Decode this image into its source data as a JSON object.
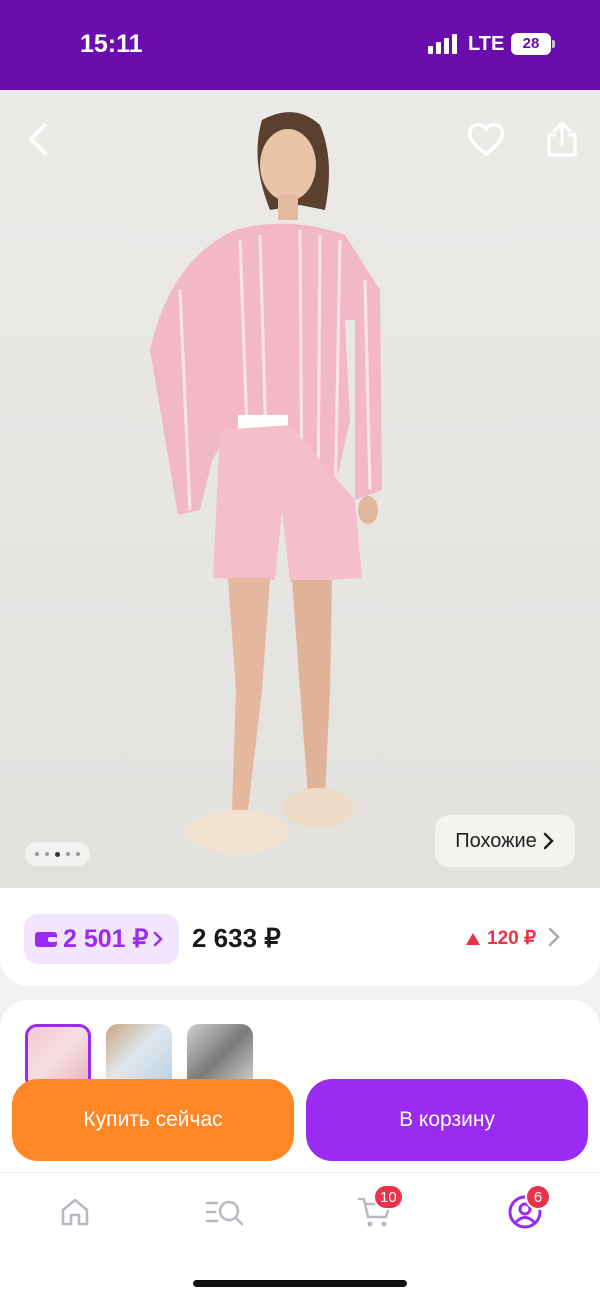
{
  "status_bar": {
    "time": "15:11",
    "network": "LTE",
    "battery": "28"
  },
  "product": {
    "similar_label": "Похожие",
    "photo_index": 3,
    "photo_count": 5,
    "wallet_price": "2 501 ₽",
    "regular_price": "2 633 ₽",
    "price_diff": "120 ₽"
  },
  "actions": {
    "buy_now": "Купить сейчас",
    "add_to_cart": "В корзину"
  },
  "tabbar": {
    "cart_badge": "10",
    "profile_badge": "6"
  },
  "colors": {
    "brand": "#6a0dad",
    "accent_purple": "#9b2bf0",
    "accent_orange": "#ff8726",
    "alert_red": "#e8334a"
  },
  "icons": [
    "back-icon",
    "heart-icon",
    "share-icon",
    "chevron-right-icon",
    "wallet-icon",
    "up-arrow-icon",
    "home-icon",
    "catalog-search-icon",
    "cart-icon",
    "profile-icon"
  ]
}
